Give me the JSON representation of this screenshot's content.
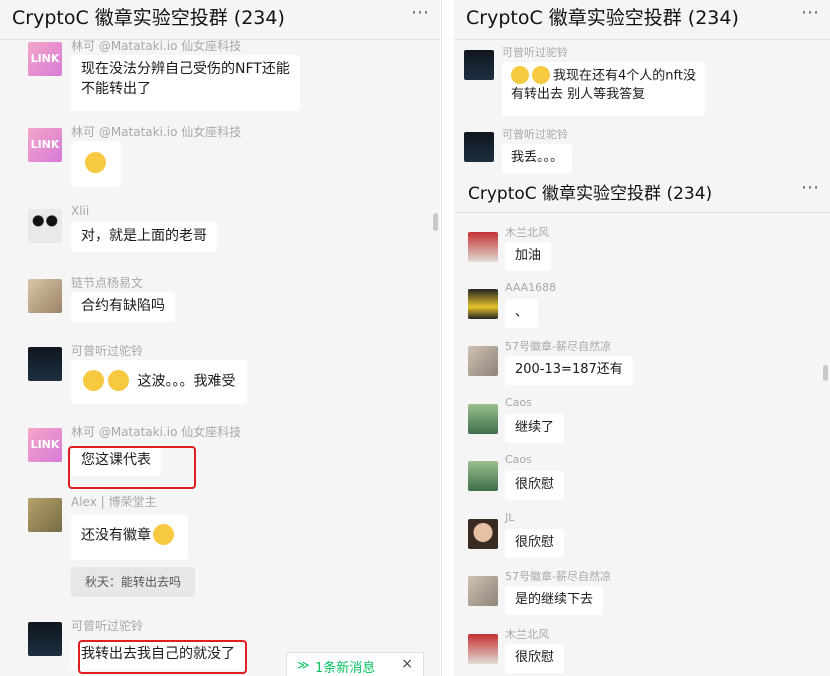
{
  "left_panel": {
    "title": "CryptoC 徽章实验空投群 (234)",
    "more_icon": "⋯",
    "messages": [
      {
        "sender": "林可 @Matataki.io 仙女座科技",
        "text": "现在没法分辨自己受伤的NFT还能",
        "text2": "不能转出了"
      },
      {
        "sender": "林可 @Matataki.io 仙女座科技"
      },
      {
        "sender": "Xlii",
        "text": "对，就是上面的老哥"
      },
      {
        "sender": "链节点杨易文",
        "text": "合约有缺陷吗"
      },
      {
        "sender": "可曾听过驼铃",
        "text": "这波。。。我难受"
      },
      {
        "sender": "林可 @Matataki.io 仙女座科技",
        "text": "您这课代表"
      },
      {
        "sender": "Alex | 博荣堂主",
        "text": "还没有徽章",
        "quote": "秋天：能转出去吗"
      },
      {
        "sender": "可曾听过驼铃",
        "text": "我转出去我自己的就没了"
      }
    ],
    "new_messages": {
      "label": "1条新消息",
      "close": "×",
      "chevron": "≫"
    }
  },
  "right_top_panel": {
    "title": "CryptoC 徽章实验空投群 (234)",
    "more_icon": "⋯",
    "messages": [
      {
        "sender": "可曾听过驼铃",
        "text": "我现在还有4个人的nft没",
        "text2": "有转出去 别人等我答复"
      },
      {
        "sender": "可曾听过驼铃",
        "text": "我丢。。。"
      }
    ]
  },
  "right_bottom_panel": {
    "title": "CryptoC 徽章实验空投群 (234)",
    "more_icon": "⋯",
    "messages": [
      {
        "sender": "木兰北风",
        "text": "加油"
      },
      {
        "sender": "AAA1688",
        "text": "、"
      },
      {
        "sender": "57号徽章-薪尽自然凉",
        "text": "200-13=187还有"
      },
      {
        "sender": "Caos",
        "text": "继续了"
      },
      {
        "sender": "Caos",
        "text": "很欣慰"
      },
      {
        "sender": "JL",
        "text": "很欣慰"
      },
      {
        "sender": "57号徽章-薪尽自然凉",
        "text": "是的继续下去"
      },
      {
        "sender": "木兰北风",
        "text": "很欣慰"
      }
    ]
  },
  "colors": {
    "highlight_box": "#e02020",
    "new_msg_accent": "#07c160",
    "bubble": "#ffffff",
    "background": "#f5f5f5"
  },
  "icons": {
    "emoji": "face-emoji-icon",
    "more": "more-icon",
    "chevron": "double-chevron-down-icon",
    "close": "close-icon"
  }
}
